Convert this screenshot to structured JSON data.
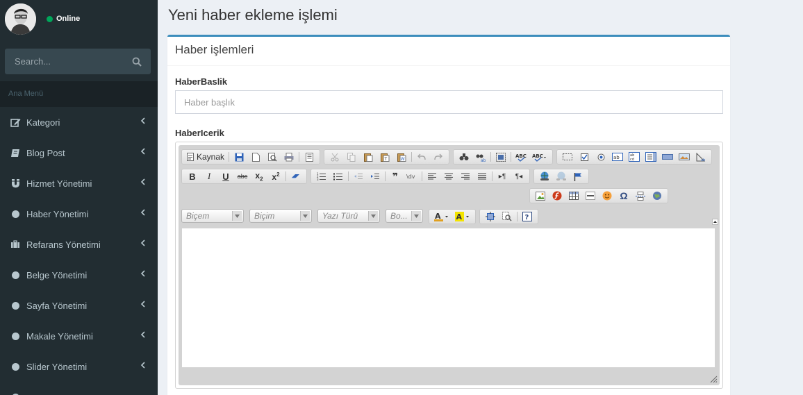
{
  "user": {
    "status": "Online"
  },
  "search": {
    "placeholder": "Search..."
  },
  "menu_header": "Ana Menü",
  "menu": [
    {
      "label": "Kategori",
      "icon": "edit-icon"
    },
    {
      "label": "Blog Post",
      "icon": "book-icon"
    },
    {
      "label": "Hizmet Yönetimi",
      "icon": "magnet-icon"
    },
    {
      "label": "Haber Yönetimi",
      "icon": "circle-icon"
    },
    {
      "label": "Refarans Yönetimi",
      "icon": "briefcase-icon"
    },
    {
      "label": "Belge Yönetimi",
      "icon": "circle-icon"
    },
    {
      "label": "Sayfa Yönetimi",
      "icon": "circle-icon"
    },
    {
      "label": "Makale Yönetimi",
      "icon": "circle-icon"
    },
    {
      "label": "Slider Yönetimi",
      "icon": "circle-icon"
    }
  ],
  "page_title": "Yeni haber ekleme işlemi",
  "box_title": "Haber işlemleri",
  "form": {
    "title_label": "HaberBaslik",
    "title_placeholder": "Haber başlık",
    "content_label": "HaberIcerik"
  },
  "editor": {
    "source_label": "Kaynak",
    "combos": [
      "Biçem",
      "Biçim",
      "Yazı Türü",
      "Bo..."
    ]
  },
  "colors": {
    "sidebar": "#222d32",
    "accent": "#3c8dbc",
    "online": "#00a65a"
  }
}
